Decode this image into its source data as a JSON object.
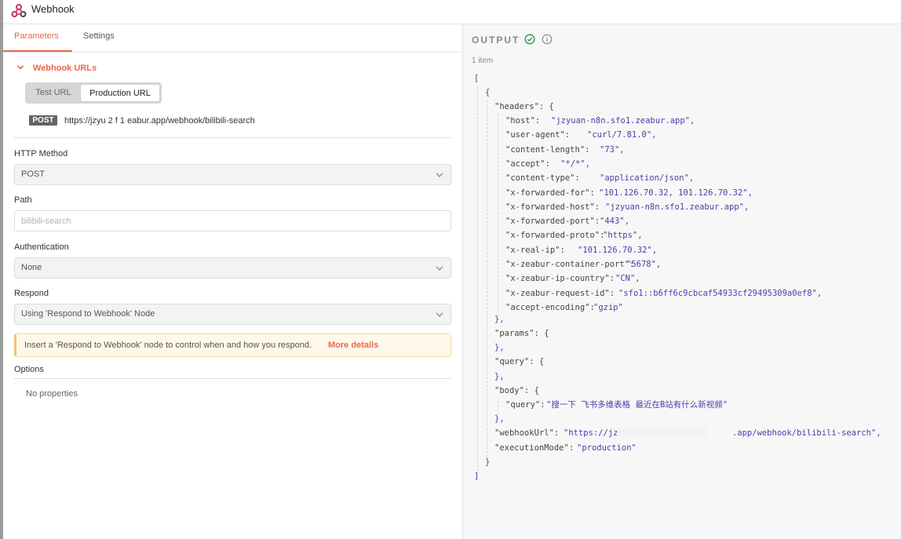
{
  "window": {
    "title": "Webhook",
    "logo_icon": "n8n-webhook-logo-icon"
  },
  "tabs": [
    {
      "label": "Parameters",
      "active": true
    },
    {
      "label": "Settings",
      "active": false
    }
  ],
  "webhook_urls": {
    "section_label": "Webhook URLs",
    "toggle": {
      "test_label": "Test URL",
      "production_label": "Production URL",
      "selected": "Production URL"
    },
    "method_badge": "POST",
    "url": "https://jzyu        2   f 1  eabur.app/webhook/bilibili-search"
  },
  "fields": {
    "http_method": {
      "label": "HTTP Method",
      "value": "POST"
    },
    "path": {
      "label": "Path",
      "placeholder": "bilibili-search"
    },
    "authentication": {
      "label": "Authentication",
      "value": "None"
    },
    "respond": {
      "label": "Respond",
      "value": "Using 'Respond to Webhook' Node"
    }
  },
  "notice": {
    "text": "Insert a 'Respond to Webhook' node to control when and how you respond.",
    "link": "More details"
  },
  "options": {
    "label": "Options",
    "empty_text": "No properties"
  },
  "output": {
    "title": "OUTPUT",
    "status_icon": "check-circle-icon",
    "info_icon": "info-icon",
    "item_count": "1 item",
    "accent_color": "#e8684a",
    "success_color": "#2b9a48",
    "json": {
      "headers_key": "\"headers\": {",
      "headers": [
        {
          "key": "\"host\":",
          "value": "\"jzyuan-n8n.sfo1.zeabur.app\","
        },
        {
          "key": "\"user-agent\":",
          "value": "\"curl/7.81.0\","
        },
        {
          "key": "\"content-length\":",
          "value": "\"73\","
        },
        {
          "key": "\"accept\":",
          "value": "\"*/*\","
        },
        {
          "key": "\"content-type\":",
          "value": "\"application/json\","
        },
        {
          "key": "\"x-forwarded-for\":",
          "value": "\"101.126.70.32, 101.126.70.32\","
        },
        {
          "key": "\"x-forwarded-host\":",
          "value": "\"jzyuan-n8n.sfo1.zeabur.app\","
        },
        {
          "key": "\"x-forwarded-port\":",
          "value": "\"443\","
        },
        {
          "key": "\"x-forwarded-proto\":",
          "value": "\"https\","
        },
        {
          "key": "\"x-real-ip\":",
          "value": "\"101.126.70.32\","
        },
        {
          "key": "\"x-zeabur-container-port\":",
          "value": "\"5678\","
        },
        {
          "key": "\"x-zeabur-ip-country\":",
          "value": "\"CN\","
        },
        {
          "key": "\"x-zeabur-request-id\":",
          "value": "\"sfo1::b6ff6c9cbcaf54933cf29495309a0ef8\","
        },
        {
          "key": "\"accept-encoding\":",
          "value": "\"gzip\""
        }
      ],
      "params_key": "\"params\": {",
      "query_key": "\"query\": {",
      "body_key": "\"body\": {",
      "body_query_key": "\"query\":",
      "body_query_value": "\"搜一下 飞书多维表格 最近在B站有什么新视频\"",
      "webhook_url_key": "\"webhookUrl\":",
      "webhook_url_value": "\"https://jz                       .app/webhook/bilibili-search\",",
      "execution_mode_key": "\"executionMode\":",
      "execution_mode_value": "\"production\""
    }
  }
}
